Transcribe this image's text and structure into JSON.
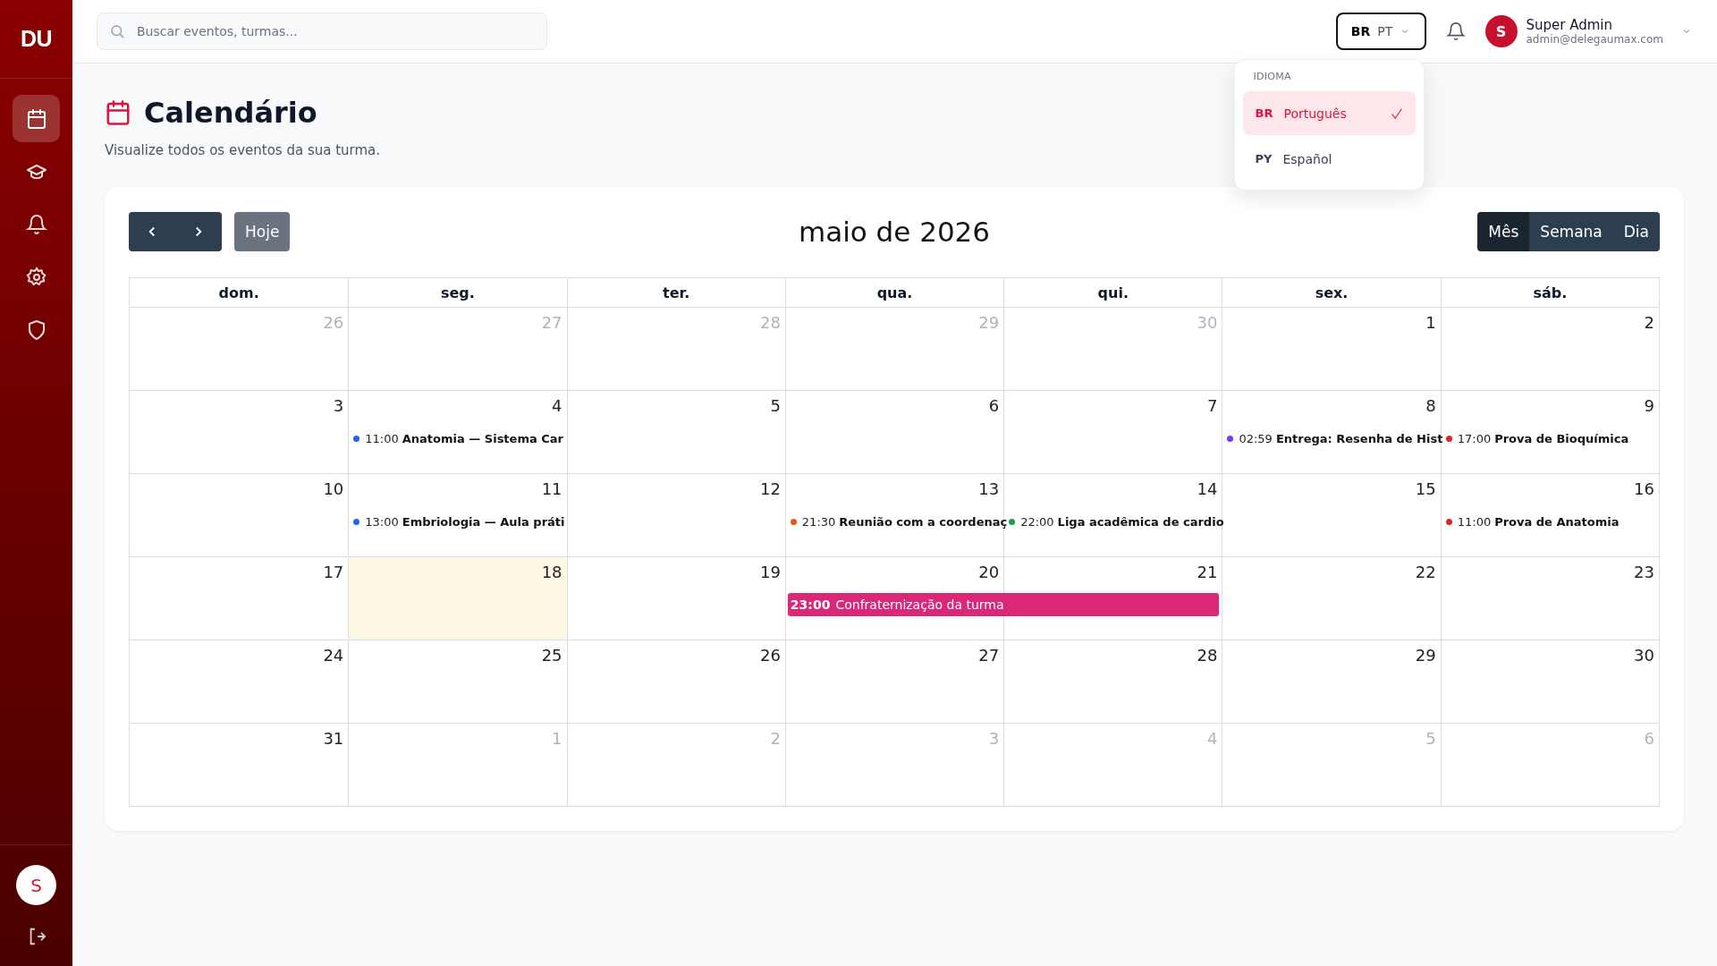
{
  "sidebar": {
    "logo": "DU",
    "items": [
      {
        "kind": "calendar",
        "selected": true
      },
      {
        "kind": "graduation",
        "selected": false
      },
      {
        "kind": "bell",
        "selected": false
      },
      {
        "kind": "gear",
        "selected": false
      },
      {
        "kind": "shield",
        "selected": false
      }
    ],
    "avatar": "S"
  },
  "topbar": {
    "search": {
      "placeholder": "Buscar eventos, turmas..."
    },
    "language": {
      "flag": "BR",
      "code": "PT",
      "expanded": true
    },
    "user": {
      "initial": "S",
      "name": "Super Admin",
      "email": "admin@delegaumax.com"
    }
  },
  "language_menu": {
    "heading": "IDIOMA",
    "options": [
      {
        "flag": "BR",
        "label": "Português",
        "selected": true
      },
      {
        "flag": "PY",
        "label": "Español",
        "selected": false
      }
    ]
  },
  "page": {
    "title": "Calendário",
    "subtitle": "Visualize todos os eventos da sua turma."
  },
  "calendar": {
    "title": "maio de 2026",
    "today_button": "Hoje",
    "views": [
      {
        "label": "Mês",
        "selected": true
      },
      {
        "label": "Semana",
        "selected": false
      },
      {
        "label": "Dia",
        "selected": false
      }
    ],
    "weekdays": [
      "dom.",
      "seg.",
      "ter.",
      "qua.",
      "qui.",
      "sex.",
      "sáb."
    ],
    "weeks": [
      {
        "days": [
          {
            "label": "26",
            "outside": true,
            "today": false
          },
          {
            "label": "27",
            "outside": true,
            "today": false
          },
          {
            "label": "28",
            "outside": true,
            "today": false
          },
          {
            "label": "29",
            "outside": true,
            "today": false
          },
          {
            "label": "30",
            "outside": true,
            "today": false
          },
          {
            "label": "1",
            "outside": false,
            "today": false
          },
          {
            "label": "2",
            "outside": false,
            "today": false
          }
        ]
      },
      {
        "days": [
          {
            "label": "3",
            "outside": false,
            "today": false
          },
          {
            "label": "4",
            "outside": false,
            "today": false,
            "events": [
              {
                "kind": "dot",
                "time": "11:00",
                "title": "Anatomia — Sistema Car",
                "color": "#2563eb"
              }
            ]
          },
          {
            "label": "5",
            "outside": false,
            "today": false
          },
          {
            "label": "6",
            "outside": false,
            "today": false
          },
          {
            "label": "7",
            "outside": false,
            "today": false
          },
          {
            "label": "8",
            "outside": false,
            "today": false,
            "events": [
              {
                "kind": "dot",
                "time": "02:59",
                "title": "Entrega: Resenha de Hist",
                "color": "#7c3aed"
              }
            ]
          },
          {
            "label": "9",
            "outside": false,
            "today": false,
            "events": [
              {
                "kind": "dot",
                "time": "17:00",
                "title": "Prova de Bioquímica",
                "color": "#dc2626"
              }
            ]
          }
        ]
      },
      {
        "days": [
          {
            "label": "10",
            "outside": false,
            "today": false
          },
          {
            "label": "11",
            "outside": false,
            "today": false,
            "events": [
              {
                "kind": "dot",
                "time": "13:00",
                "title": "Embriologia — Aula práti",
                "color": "#2563eb"
              }
            ]
          },
          {
            "label": "12",
            "outside": false,
            "today": false
          },
          {
            "label": "13",
            "outside": false,
            "today": false,
            "events": [
              {
                "kind": "dot",
                "time": "21:30",
                "title": "Reunião com a coordenaç",
                "color": "#ea580c"
              }
            ]
          },
          {
            "label": "14",
            "outside": false,
            "today": false,
            "events": [
              {
                "kind": "dot",
                "time": "22:00",
                "title": "Liga acadêmica de cardio",
                "color": "#16a34a"
              }
            ]
          },
          {
            "label": "15",
            "outside": false,
            "today": false
          },
          {
            "label": "16",
            "outside": false,
            "today": false,
            "events": [
              {
                "kind": "dot",
                "time": "11:00",
                "title": "Prova de Anatomia",
                "color": "#dc2626"
              }
            ]
          }
        ]
      },
      {
        "days": [
          {
            "label": "17",
            "outside": false,
            "today": false
          },
          {
            "label": "18",
            "outside": false,
            "today": true
          },
          {
            "label": "19",
            "outside": false,
            "today": false
          },
          {
            "label": "20",
            "outside": false,
            "today": false,
            "events": [
              {
                "kind": "bar",
                "time": "23:00",
                "title": "Confraternização da turma",
                "color": "#db2777"
              }
            ]
          },
          {
            "label": "21",
            "outside": false,
            "today": false,
            "event_continues": true
          },
          {
            "label": "22",
            "outside": false,
            "today": false
          },
          {
            "label": "23",
            "outside": false,
            "today": false
          }
        ]
      },
      {
        "days": [
          {
            "label": "24",
            "outside": false,
            "today": false
          },
          {
            "label": "25",
            "outside": false,
            "today": false
          },
          {
            "label": "26",
            "outside": false,
            "today": false
          },
          {
            "label": "27",
            "outside": false,
            "today": false
          },
          {
            "label": "28",
            "outside": false,
            "today": false
          },
          {
            "label": "29",
            "outside": false,
            "today": false
          },
          {
            "label": "30",
            "outside": false,
            "today": false
          }
        ]
      },
      {
        "days": [
          {
            "label": "31",
            "outside": false,
            "today": false
          },
          {
            "label": "1",
            "outside": true,
            "today": false
          },
          {
            "label": "2",
            "outside": true,
            "today": false
          },
          {
            "label": "3",
            "outside": true,
            "today": false
          },
          {
            "label": "4",
            "outside": true,
            "today": false
          },
          {
            "label": "5",
            "outside": true,
            "today": false
          },
          {
            "label": "6",
            "outside": true,
            "today": false
          }
        ]
      }
    ]
  }
}
